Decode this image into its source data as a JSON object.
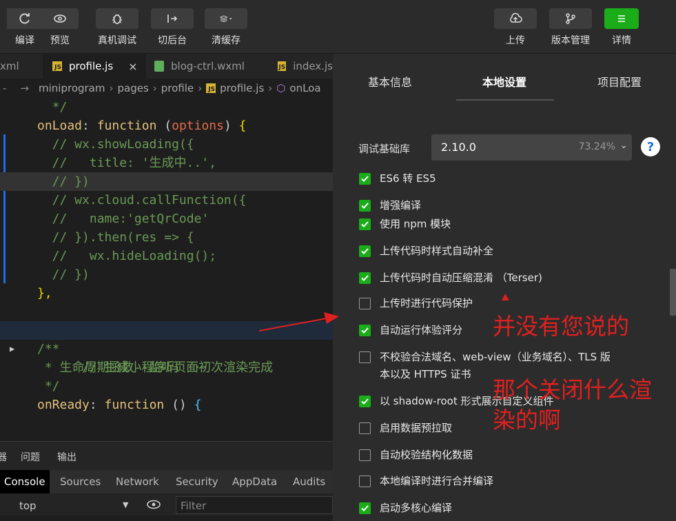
{
  "toolbar": {
    "left": [
      {
        "label": "编译"
      },
      {
        "label": "预览"
      },
      {
        "label": "真机调试"
      },
      {
        "label": "切后台"
      },
      {
        "label": "清缓存"
      }
    ],
    "right": [
      {
        "label": "上传"
      },
      {
        "label": "版本管理"
      },
      {
        "label": "详情"
      }
    ],
    "accent": "#1aad19"
  },
  "editor": {
    "tabs": [
      {
        "name": "xml"
      },
      {
        "name": "profile.js",
        "close": "×"
      },
      {
        "name": "blog-ctrl.wxml"
      },
      {
        "name": "index.js"
      }
    ],
    "breadcrumb": {
      "path": [
        "miniprogram",
        "pages",
        "profile",
        "profile.js",
        "onLoa"
      ]
    },
    "code": [
      "  */",
      "onLoad: function (options) {",
      "  // wx.showLoading({",
      "  //   title: '生成中..',",
      "  // })",
      "  // wx.cloud.callFunction({",
      "  //   name:'getQrCode'",
      "  // }).then(res => {",
      "  //   wx.hideLoading();",
      "  // })",
      "},",
      "",
      "// 生成小程序码 ···",
      "/**",
      " * 生命周期函数--监听页面初次渲染完成",
      " */",
      "onReady: function () {"
    ]
  },
  "bottom_panel": {
    "tabs": [
      "器",
      "问题",
      "输出"
    ],
    "devtools_tabs": [
      "Console",
      "Sources",
      "Network",
      "Security",
      "AppData",
      "Audits"
    ],
    "context": "top",
    "filter_placeholder": "Filter"
  },
  "settings": {
    "tabs": [
      "基本信息",
      "本地设置",
      "项目配置"
    ],
    "active_tab": "本地设置",
    "lib_label": "调试基础库",
    "lib_version": "2.10.0",
    "lib_percent": "73.24%",
    "help": "?",
    "options": [
      {
        "label": "ES6 转 ES5",
        "checked": true
      },
      {
        "label": "增强编译",
        "checked": true
      },
      {
        "label": "使用 npm 模块",
        "checked": true
      },
      {
        "label": "上传代码时样式自动补全",
        "checked": true
      },
      {
        "label": "上传代码时自动压缩混淆 （Terser)",
        "checked": true
      },
      {
        "label": "上传时进行代码保护",
        "checked": false
      },
      {
        "label": "自动运行体验评分",
        "checked": true
      },
      {
        "label": "不校验合法域名、web-view（业务域名）、TLS 版",
        "label2": "本以及 HTTPS 证书",
        "checked": false
      },
      {
        "label": "以 shadow-root 形式展示自定义组件",
        "checked": true
      },
      {
        "label": "启用数据预拉取",
        "checked": false
      },
      {
        "label": "自动校验结构化数据",
        "checked": false
      },
      {
        "label": "本地编译时进行合并编译",
        "checked": false
      },
      {
        "label": "启动多核心编译",
        "checked": true
      }
    ]
  },
  "annotations": {
    "line1": "并没有您说的",
    "line2": "那个关闭什么渲",
    "line3": "染的啊",
    "color": "#e02020"
  }
}
